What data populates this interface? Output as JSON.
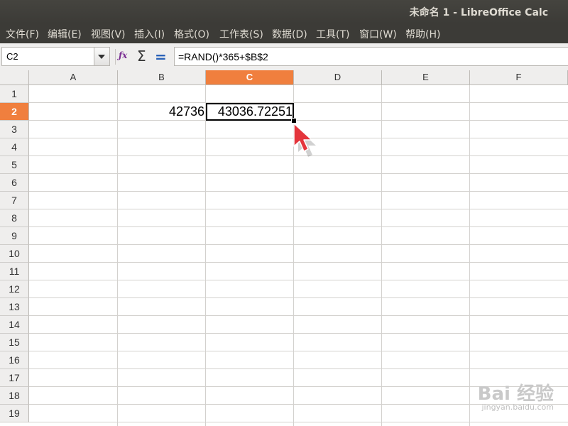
{
  "window": {
    "title": "未命名 1 - LibreOffice Calc"
  },
  "menu": [
    "文件(F)",
    "编辑(E)",
    "视图(V)",
    "插入(I)",
    "格式(O)",
    "工作表(S)",
    "数据(D)",
    "工具(T)",
    "窗口(W)",
    "帮助(H)"
  ],
  "toolbar": {
    "name_box": "C2",
    "formula": "=RAND()*365+$B$2",
    "icons": [
      "function-wizard-icon",
      "sum-icon",
      "formula-icon"
    ]
  },
  "sheet": {
    "columns": [
      "A",
      "B",
      "C",
      "D",
      "E",
      "F"
    ],
    "rows": [
      "1",
      "2",
      "3",
      "4",
      "5",
      "6",
      "7",
      "8",
      "9",
      "10",
      "11",
      "12",
      "13",
      "14",
      "15",
      "16",
      "17",
      "18",
      "19"
    ],
    "selected_column": "C",
    "selected_row": "2",
    "cells": {
      "B2": "42736",
      "C2": "43036.72251"
    }
  },
  "colors": {
    "header_selected": "#f07f3e",
    "titlebar": "#3c3b37",
    "pointer": "#e4353c"
  },
  "watermark": {
    "main": "Bai 经验",
    "sub": "jingyan.baidu.com"
  }
}
